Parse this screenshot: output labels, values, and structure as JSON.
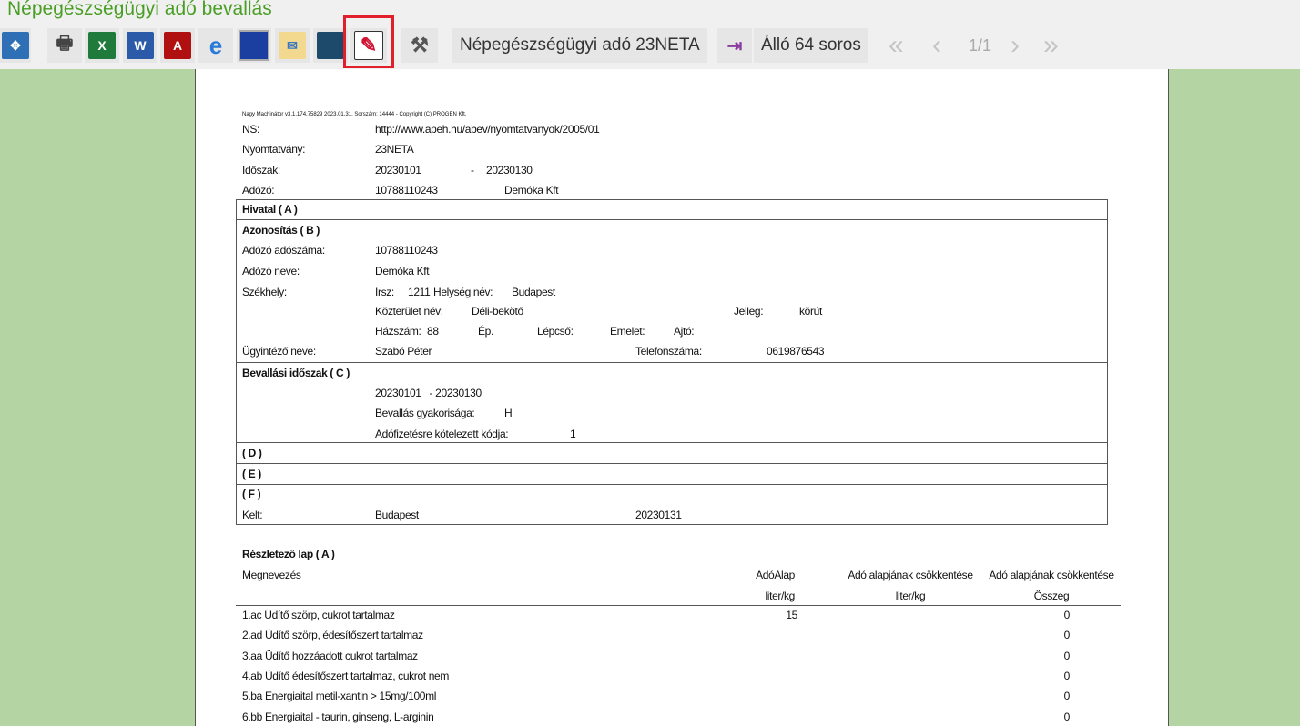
{
  "window_title": "Népegészségügyi adó bevallás",
  "toolbar": {
    "form_label": "Népegészségügyi adó 23NETA",
    "orientation_label": "Álló 64 soros",
    "page_indicator": "1/1"
  },
  "doc": {
    "header_note": "Nagy Machinátor v3.1.174.75829 2023.01.31. Sorszám: 14444 - Copyright (C) PROGEN Kft.",
    "ns_label": "NS:",
    "ns_value": "http://www.apeh.hu/abev/nyomtatvanyok/2005/01",
    "form_label": "Nyomtatvány:",
    "form_value": "23NETA",
    "period_label": "Időszak:",
    "period_from": "20230101",
    "period_dash": "-",
    "period_to": "20230130",
    "taxpayer_label": "Adózó:",
    "taxpayer_id": "10788110243",
    "taxpayer_name": "Demóka Kft",
    "sec_a": "Hivatal ( A )",
    "sec_b": "Azonosítás ( B )",
    "tax_number_label": "Adózó adószáma:",
    "tax_number": "10788110243",
    "name_label": "Adózó neve:",
    "name": "Demóka Kft",
    "seat_label": "Székhely:",
    "zip_label": "Irsz:",
    "zip": "1211",
    "city_label": "Helység név:",
    "city": "Budapest",
    "street_label": "Közterület név:",
    "street": "Déli-bekötő",
    "type_label": "Jelleg:",
    "type": "körút",
    "house_label": "Házszám:",
    "house": "88",
    "building_label": "Ép.",
    "stair_label": "Lépcső:",
    "floor_label": "Emelet:",
    "door_label": "Ajtó:",
    "admin_label": "Ügyintéző neve:",
    "admin": "Szabó Péter",
    "phone_label": "Telefonszáma:",
    "phone": "0619876543",
    "sec_c": "Bevallási időszak ( C )",
    "c_period": "20230101   - 20230130",
    "freq_label": "Bevallás gyakorisága:",
    "freq": "H",
    "code_label": "Adófizetésre kötelezett kódja:",
    "code": "1",
    "sec_d": "( D )",
    "sec_e": "( E )",
    "sec_f": "( F )",
    "kelt_label": "Kelt:",
    "kelt_city": "Budapest",
    "kelt_date": "20230131",
    "detail_title": "Részletező lap ( A )",
    "col_name": "Megnevezés",
    "col1": "AdóAlap",
    "col1_unit": "liter/kg",
    "col2": "Adó alapjának csökkentése",
    "col2_unit": "liter/kg",
    "col3": "Adó alapjának csökkentése",
    "col3_unit": "Összeg",
    "rows": [
      {
        "name": "1.ac Üdítő szörp, cukrot tartalmaz",
        "base": "15",
        "sum": "0"
      },
      {
        "name": "2.ad Üdítő szörp, édesítőszert tartalmaz",
        "base": "",
        "sum": "0"
      },
      {
        "name": "3.aa Üdítő hozzáadott cukrot tartalmaz",
        "base": "",
        "sum": "0"
      },
      {
        "name": "4.ab Üdítő édesítőszert tartalmaz, cukrot nem",
        "base": "",
        "sum": "0"
      },
      {
        "name": "5.ba Energiaital metil-xantin > 15mg/100ml",
        "base": "",
        "sum": "0"
      },
      {
        "name": "6.bb Energiaital - taurin, ginseng, L-arginin",
        "base": "",
        "sum": "0"
      }
    ]
  }
}
